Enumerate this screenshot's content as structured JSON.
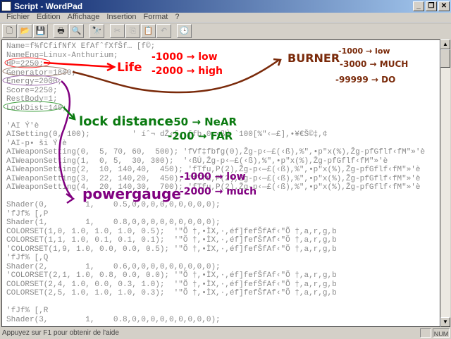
{
  "window": {
    "title": "Script - WordPad",
    "minimize": "_",
    "restore": "❐",
    "close": "✕"
  },
  "menu": [
    "Fichier",
    "Edition",
    "Affichage",
    "Insertion",
    "Format",
    "?"
  ],
  "toolbar": [
    {
      "name": "new",
      "glyph": "🗋"
    },
    {
      "name": "open",
      "glyph": "📂"
    },
    {
      "name": "save",
      "glyph": "💾"
    },
    {
      "name": "print",
      "glyph": "🖶"
    },
    {
      "name": "print-preview",
      "glyph": "🔍"
    },
    {
      "name": "find",
      "glyph": "🔭"
    },
    {
      "name": "cut",
      "glyph": "✂"
    },
    {
      "name": "copy",
      "glyph": "⎘"
    },
    {
      "name": "paste",
      "glyph": "📋"
    },
    {
      "name": "undo",
      "glyph": "↶"
    },
    {
      "name": "date-time",
      "glyph": "🕒"
    }
  ],
  "document": {
    "lines": [
      "Name=f¾fCfifNfX EfAfˆfXfŠf… [f©;",
      "NameEng=Linux-Anthurium;",
      "HP=2250;",
      "Generator=1800;",
      "Energy=2000;",
      "Score=2250;",
      "RestBody=1;",
      "LockDist=140;",
      "",
      "'AI Ý'è",
      "AISetting(0, 100);         ' íˆ¬ dŽ‹f, [fb 0 ‹ßÚ `100[%\"‹—£],•¥€Š©‡,¢",
      "'AI-p• ši Ý'è",
      "AIWeaponSetting(0,  5, 70, 60,  500); 'fVf‡fbfg(0),Žg-p‹—£(‹ß),%\",•p\"x(%),Žg-pfGflf‹fM\"»'è",
      "AIWeaponSetting(1,  0, 5,  30, 300);  '‹ßÚ,Žg-p‹—£(‹ß),%\",•p\"x(%),Žg-pfGflf‹fM\"»'è",
      "AIWeaponSetting(2,  10, 140,40,  450); 'fTfu,P(2),Žg-p‹—£(‹ß),%\",•p\"x(%),Žg-pfGflf‹fM\"»'è",
      "AIWeaponSetting(3,  22, 140,20,  450); 'fTfu,P(2),Žg-p‹—£(‹ß),%\",•p\"x(%),Žg-pfGflf‹fM\"»'è",
      "AIWeaponSetting(4,  20, 140,30,  700); 'fTfu,P(2),Žg-p‹—£(‹ß),%\",•p\"x(%),Žg-pfGflf‹fM\"»'è",
      "",
      "Shader(0,        1,    0.5,0,0,0,0,0,0,0,0,0);",
      "'fJf% [,P",
      "Shader(1,        1,    0.8,0,0,0,0,0,0,0,0,0);",
      "COLORSET(1,0, 1.0, 1.0, 1.0, 0.5);  '\"Õ †,•ÌX,·,éf]fefŠfAf‹\"Õ †,a,r,g,b",
      "COLORSET(1,1, 1.0, 0.1, 0.1, 0.1);  '\"Õ †,•ÌX,·,éf]fefŠfAf‹\"Õ †,a,r,g,b",
      "'COLORSET(1,9, 1.0, 0.0, 0.0, 0.5); '\"Õ †,•ÌX,·,éf]fefŠfAf‹\"Õ †,a,r,g,b",
      "'fJf% [,Q",
      "Shader(2,        1,    0.6,0,0,0,0,0,0,0,0,0);",
      "'COLORSET(2,1, 1.0, 0.8, 0.0, 0.0); '\"Õ †,•ÌX,·,éf]fefŠfAf‹\"Õ †,a,r,g,b",
      "COLORSET(2,4, 1.0, 0.0, 0.3, 1.0);  '\"Õ †,•ÌX,·,éf]fefŠfAf‹\"Õ †,a,r,g,b",
      "COLORSET(2,5, 1.0, 1.0, 1.0, 0.3);  '\"Õ †,•ÌX,·,éf]fefŠfAf‹\"Õ †,a,r,g,b",
      "",
      "'fJf% [,R",
      "Shader(3,        1,    0.8,0,0,0,0,0,0,0,0,0);"
    ]
  },
  "annotations": {
    "life": {
      "label": "Life",
      "low": "-1000 → low",
      "high": "-2000 → high",
      "color": "#ff0000"
    },
    "burner": {
      "label": "BURNER",
      "l1": "-1000 → low",
      "l2": "-3000 → MUCH",
      "l3": "-99999 → DO",
      "color": "#7a2a0a"
    },
    "lock": {
      "label": "lock distance",
      "near": "-50 → NeAR",
      "far": "-200 → FAR",
      "color": "#0a7a10"
    },
    "power": {
      "label": "powergauge",
      "low": "-1000 → low",
      "much": "-2000 → much",
      "color": "#800080"
    }
  },
  "status": {
    "help": "Appuyez sur F1 pour obtenir de l'aide",
    "num": "NUM"
  }
}
